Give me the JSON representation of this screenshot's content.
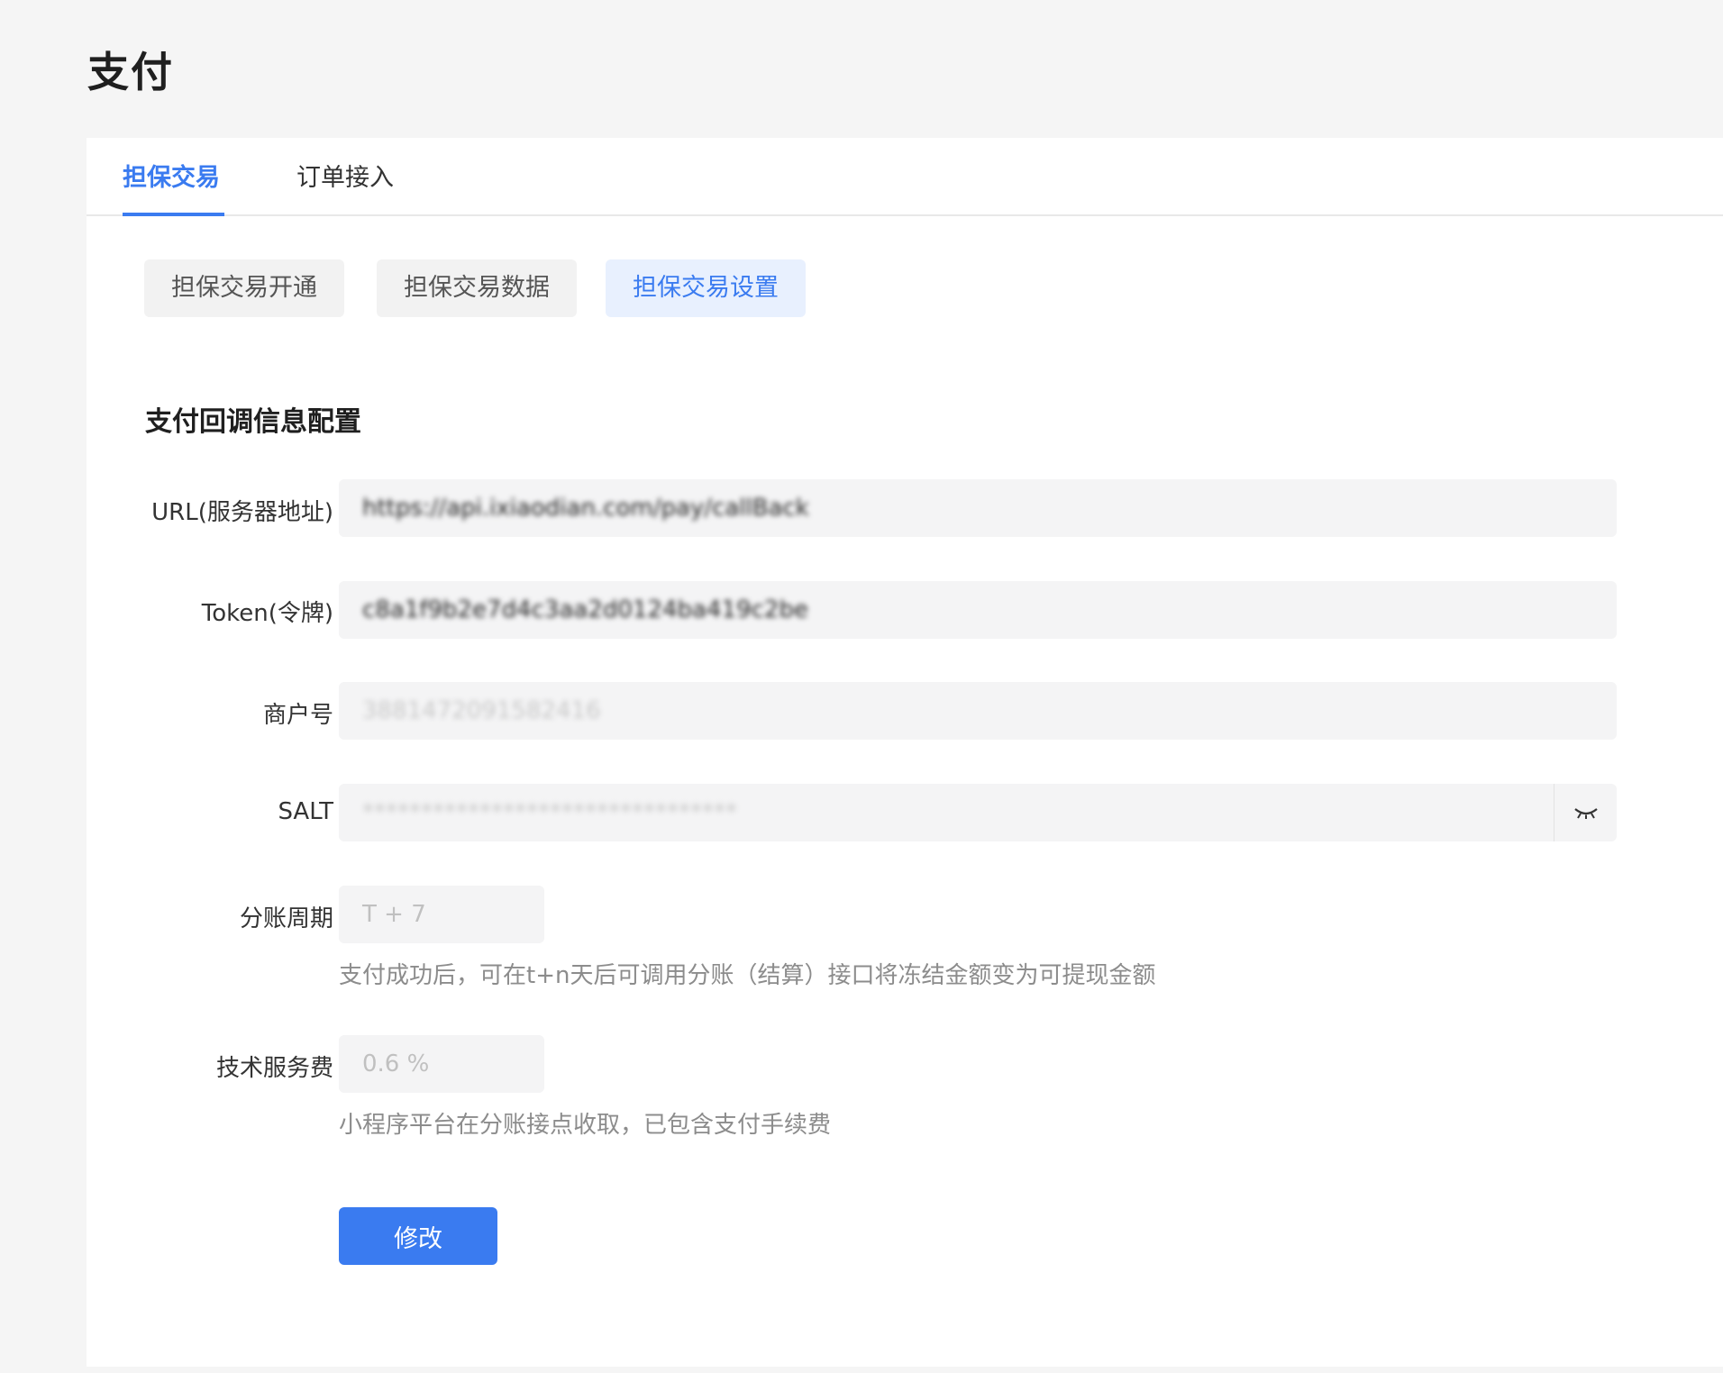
{
  "page": {
    "title": "支付"
  },
  "tabs": [
    {
      "label": "担保交易",
      "active": true
    },
    {
      "label": "订单接入",
      "active": false
    }
  ],
  "subtabs": [
    {
      "label": "担保交易开通",
      "active": false
    },
    {
      "label": "担保交易数据",
      "active": false
    },
    {
      "label": "担保交易设置",
      "active": true
    }
  ],
  "section": {
    "title": "支付回调信息配置"
  },
  "fields": {
    "url": {
      "label": "URL(服务器地址)",
      "value": "https://api.ixiaodian.com/pay/callBack"
    },
    "token": {
      "label": "Token(令牌)",
      "value": "c8a1f9b2e7d4c3aa2d0124ba419c2be"
    },
    "merchant": {
      "label": "商户号",
      "value": "3881472091582416"
    },
    "salt": {
      "label": "SALT",
      "value": "********************************",
      "icon": "eye-closed-icon"
    },
    "cycle": {
      "label": "分账周期",
      "value": "T + 7",
      "hint": "支付成功后，可在t+n天后可调用分账（结算）接口将冻结金额变为可提现金额"
    },
    "fee": {
      "label": "技术服务费",
      "value": "0.6 %",
      "hint": "小程序平台在分账接点收取，已包含支付手续费"
    }
  },
  "actions": {
    "submit_label": "修改"
  },
  "colors": {
    "accent": "#3a7bf0",
    "active_subtab_bg": "#e8f0fe",
    "input_bg": "#f4f4f5"
  }
}
